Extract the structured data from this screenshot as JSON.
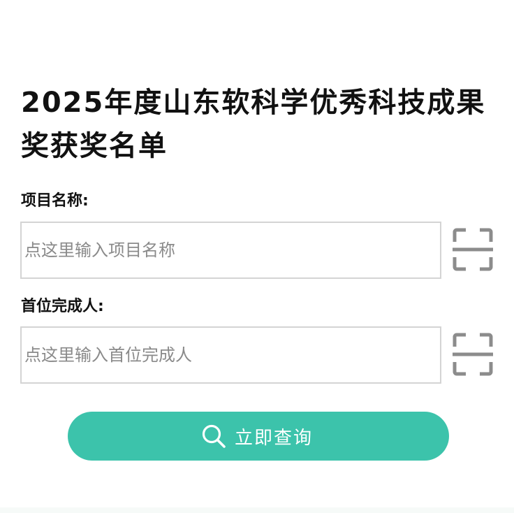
{
  "form": {
    "title": "2025年度山东软科学优秀科技成果奖获奖名单",
    "project_name_label": "项目名称:",
    "project_name_placeholder": "点这里输入项目名称",
    "project_name_value": "",
    "first_completer_label": "首位完成人:",
    "first_completer_placeholder": "点这里输入首位完成人",
    "first_completer_value": "",
    "scan_icon": "scan-icon",
    "search_icon": "search-icon",
    "search_button_label": "立即查询"
  },
  "colors": {
    "accent": "#3cc3ab",
    "input_border": "#d4d4d4",
    "placeholder": "#8a8a8a",
    "icon_gray": "#8c8c8c",
    "title_text": "#111111"
  }
}
